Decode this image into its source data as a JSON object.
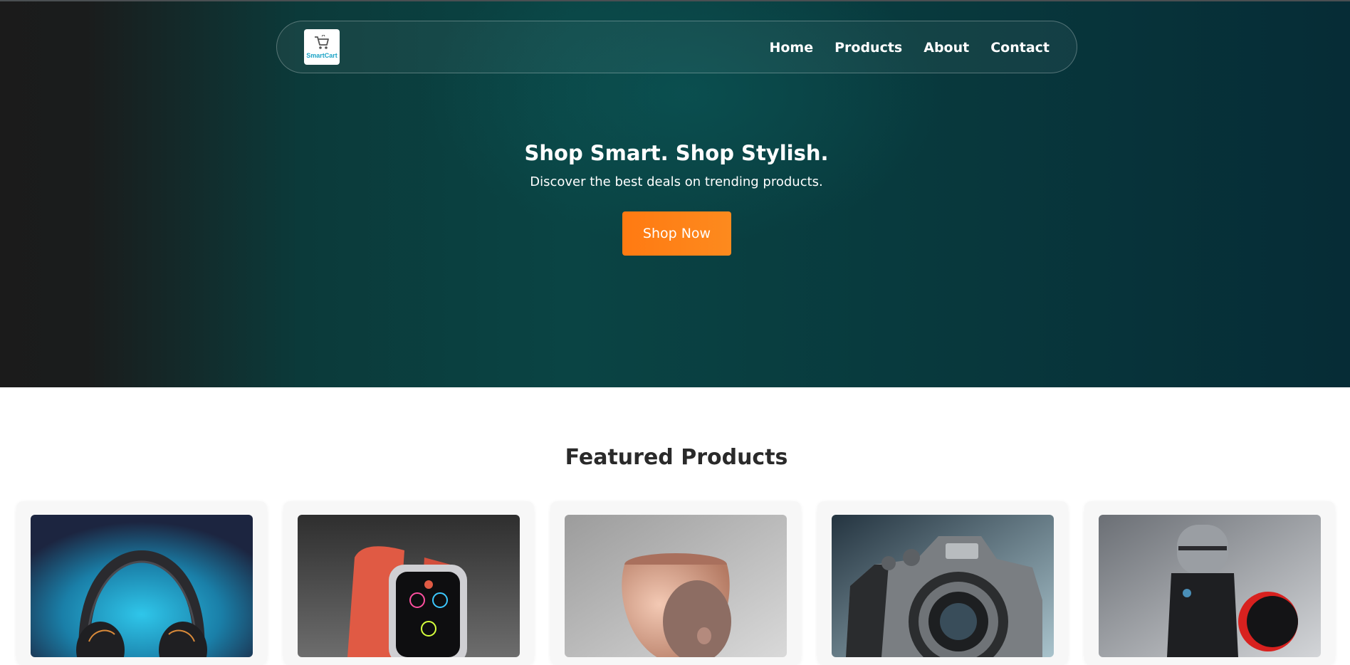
{
  "brand": {
    "logo_text": "SmartCart",
    "logo_icon": "shopping-cart-icon"
  },
  "nav": {
    "items": [
      "Home",
      "Products",
      "About",
      "Contact"
    ]
  },
  "hero": {
    "title": "Shop Smart. Shop Stylish.",
    "subtitle": "Discover the best deals on trending products.",
    "cta_label": "Shop Now"
  },
  "featured": {
    "title": "Featured Products",
    "products": [
      {
        "image": "headphones-image"
      },
      {
        "image": "smartwatch-image"
      },
      {
        "image": "speaker-image"
      },
      {
        "image": "camera-image"
      },
      {
        "image": "microphone-image"
      }
    ]
  },
  "colors": {
    "accent": "#ff7a12",
    "hero_dark": "#1b1b1b",
    "hero_teal": "#0a4444",
    "logo_text": "#1aa3c6"
  }
}
